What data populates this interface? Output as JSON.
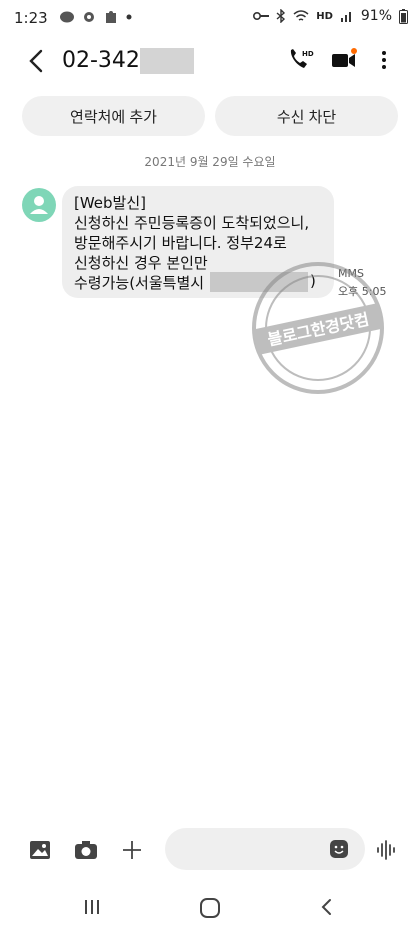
{
  "status_bar": {
    "time": "1:23",
    "battery": "91%",
    "hd_label": "HD"
  },
  "header": {
    "phone_number": "02-3423"
  },
  "quick_actions": {
    "add_contact": "연락처에 추가",
    "block": "수신 차단"
  },
  "date_divider": "2021년 9월 29일 수요일",
  "message": {
    "lines": [
      "[Web발신]",
      "신청하신 주민등록증이 도착되었으니,",
      "방문해주시기 바랍니다. 정부24로",
      "신청하신 경우 본인만",
      "수령가능(서울특별시",
      ")"
    ],
    "type": "MMS",
    "time": "오후 5:05"
  },
  "watermark": {
    "text": "블로그한경닷컴"
  },
  "colors": {
    "avatar": "#7fd6b7",
    "bubble": "#eeeeee",
    "accent_dot": "#ff6a00"
  }
}
